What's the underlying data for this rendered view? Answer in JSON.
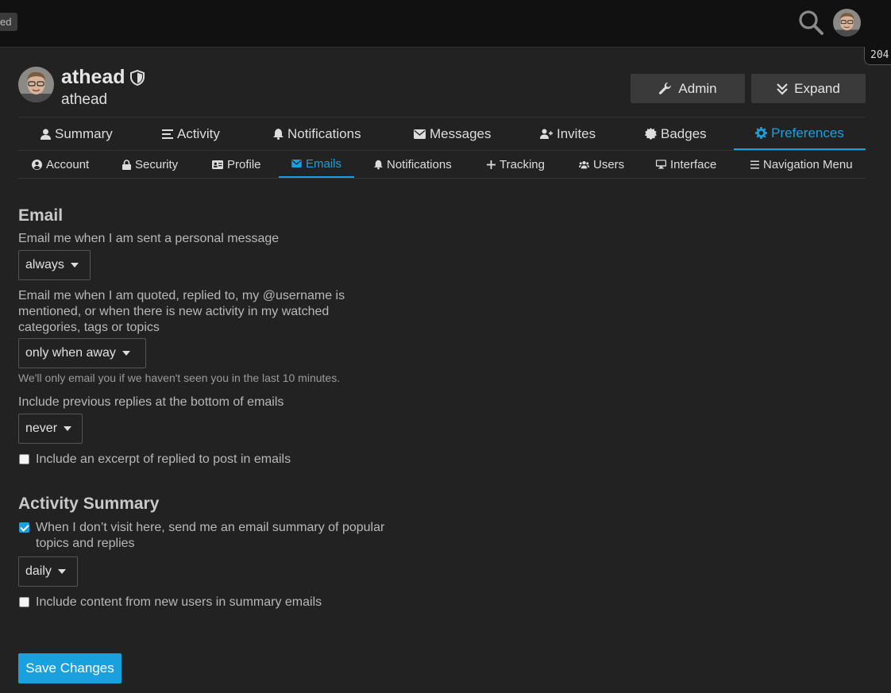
{
  "header": {
    "badge_partial": "ed",
    "search_icon": "search-icon",
    "notification_count": "204"
  },
  "user": {
    "username": "athead",
    "name": "athead",
    "admin_button": "Admin",
    "expand_button": "Expand"
  },
  "main_nav": [
    {
      "label": "Summary",
      "icon": "user-icon"
    },
    {
      "label": "Activity",
      "icon": "list-icon"
    },
    {
      "label": "Notifications",
      "icon": "bell-icon"
    },
    {
      "label": "Messages",
      "icon": "envelope-icon"
    },
    {
      "label": "Invites",
      "icon": "user-plus-icon"
    },
    {
      "label": "Badges",
      "icon": "certificate-icon"
    },
    {
      "label": "Preferences",
      "icon": "gear-icon",
      "active": true
    }
  ],
  "sub_nav": [
    {
      "label": "Account",
      "icon": "user-circle-icon"
    },
    {
      "label": "Security",
      "icon": "lock-icon"
    },
    {
      "label": "Profile",
      "icon": "id-card-icon"
    },
    {
      "label": "Emails",
      "icon": "envelope-icon",
      "active": true
    },
    {
      "label": "Notifications",
      "icon": "bell-icon"
    },
    {
      "label": "Tracking",
      "icon": "plus-icon"
    },
    {
      "label": "Users",
      "icon": "users-icon"
    },
    {
      "label": "Interface",
      "icon": "desktop-icon"
    },
    {
      "label": "Navigation Menu",
      "icon": "bars-icon"
    }
  ],
  "email_section": {
    "title": "Email",
    "pm_label": "Email me when I am sent a personal message",
    "pm_value": "always",
    "mention_label": "Email me when I am quoted, replied to, my @username is mentioned, or when there is new activity in my watched categories, tags or topics",
    "mention_value": "only when away",
    "away_hint": "We'll only email you if we haven't seen you in the last 10 minutes.",
    "previous_replies_label": "Include previous replies at the bottom of emails",
    "previous_replies_value": "never",
    "excerpt_label": "Include an excerpt of replied to post in emails",
    "excerpt_checked": false
  },
  "activity_section": {
    "title": "Activity Summary",
    "digest_label": "When I don’t visit here, send me an email summary of popular topics and replies",
    "digest_checked": true,
    "digest_frequency": "daily",
    "new_users_label": "Include content from new users in summary emails",
    "new_users_checked": false
  },
  "save_button": "Save Changes",
  "colors": {
    "accent": "#1aa0dc",
    "background": "#222222",
    "header": "#111111"
  }
}
